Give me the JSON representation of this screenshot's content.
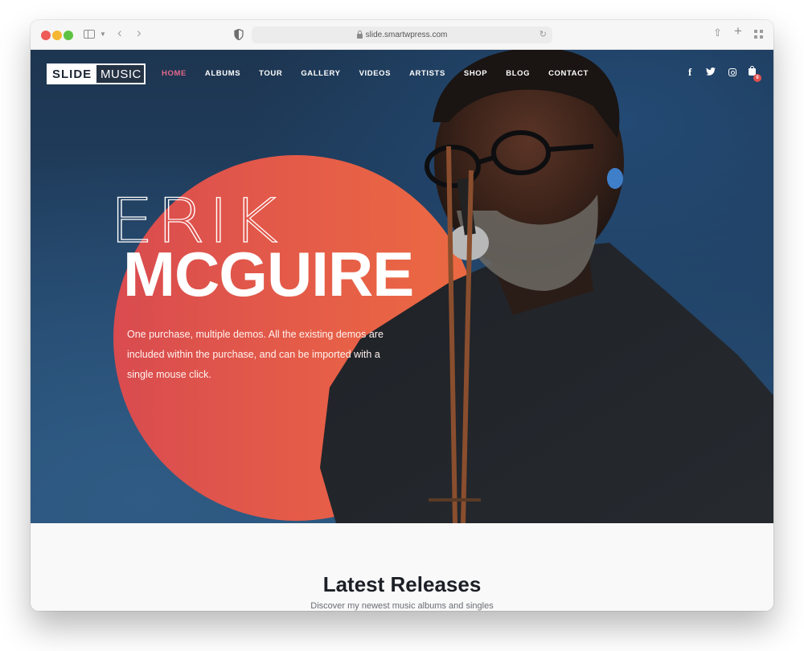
{
  "browser": {
    "url": "slide.smartwpress.com",
    "icons": [
      "sidebar-toggle-icon",
      "chevron-down-icon",
      "back-icon",
      "forward-icon",
      "privacy-shield-icon",
      "lock-icon",
      "reload-icon",
      "share-icon",
      "new-tab-icon",
      "tab-overview-icon"
    ]
  },
  "site": {
    "logo": {
      "part1": "SLIDE",
      "part2": "MUSIC"
    },
    "nav": [
      {
        "label": "HOME",
        "active": true
      },
      {
        "label": "ALBUMS",
        "active": false
      },
      {
        "label": "TOUR",
        "active": false
      },
      {
        "label": "GALLERY",
        "active": false
      },
      {
        "label": "VIDEOS",
        "active": false
      },
      {
        "label": "ARTISTS",
        "active": false
      },
      {
        "label": "SHOP",
        "active": false
      },
      {
        "label": "BLOG",
        "active": false
      },
      {
        "label": "CONTACT",
        "active": false
      }
    ],
    "social": {
      "facebook": "f",
      "twitter": "🐦",
      "instagram": "instagram-icon",
      "cart_count": "0"
    },
    "colors": {
      "active_nav": "#e3688a",
      "circle_start": "#d94b4f",
      "circle_end": "#ec6a42",
      "hero_bg": "#23456a",
      "cart_badge": "#e0514f"
    }
  },
  "hero": {
    "first_name": "ERIK",
    "last_name": "MCGUIRE",
    "description": "One purchase, multiple demos. All the existing demos are included within the purchase, and can be imported with a single mouse click."
  },
  "releases": {
    "title": "Latest Releases",
    "subtitle": "Discover my newest music albums and singles"
  }
}
